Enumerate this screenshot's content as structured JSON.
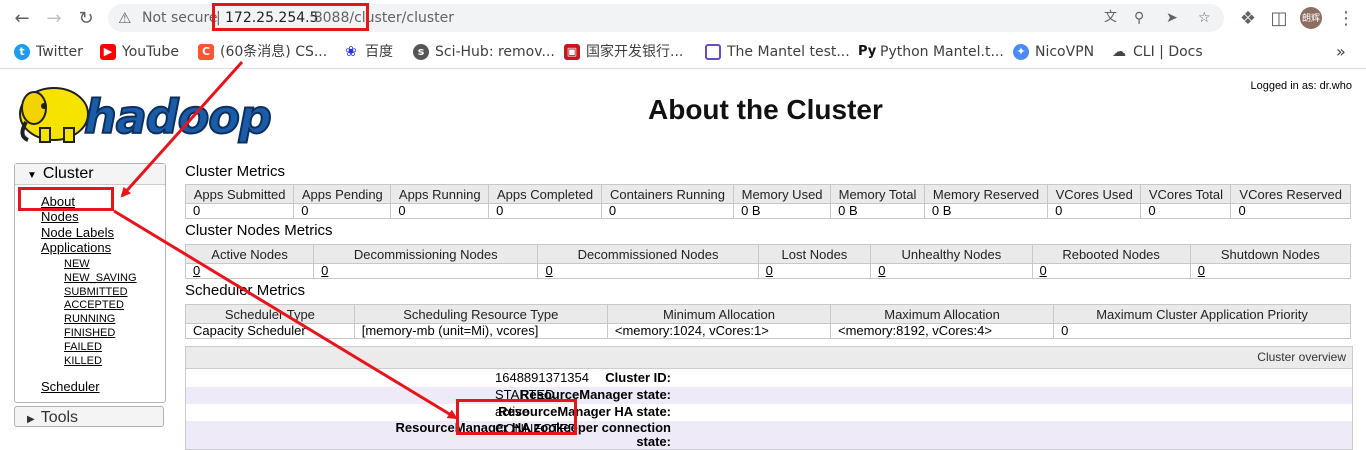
{
  "browser": {
    "security_label": "Not secure",
    "url_host": "172.25.254.5",
    "url_rest": ":8088/cluster/cluster",
    "profile_name": "朗辉"
  },
  "bookmarks": [
    {
      "label": "Twitter",
      "icon": "twitter-bird-icon",
      "color": "#1d9bf0"
    },
    {
      "label": "YouTube",
      "icon": "youtube-icon",
      "color": "#ff0000"
    },
    {
      "label": "(60条消息) CS...",
      "icon": "csdn-icon",
      "color": "#fc5531"
    },
    {
      "label": "百度",
      "icon": "baidu-paw-icon",
      "color": "#2932e1"
    },
    {
      "label": "Sci-Hub: remov...",
      "icon": "scihub-icon",
      "color": "#555555"
    },
    {
      "label": "国家开发银行...",
      "icon": "cdb-icon",
      "color": "#c8161d"
    },
    {
      "label": "The Mantel test...",
      "icon": "page-icon",
      "color": "#6a4bc3"
    },
    {
      "label": "Python Mantel.t...",
      "icon": "py-icon",
      "color": "#111111"
    },
    {
      "label": "NicoVPN",
      "icon": "nicovpn-icon",
      "color": "#4c8bf5"
    },
    {
      "label": "CLI | Docs",
      "icon": "cloud-icon",
      "color": "#444444"
    }
  ],
  "page": {
    "logged_in": "Logged in as: dr.who",
    "title": "About the Cluster",
    "logo_text": "hadoop"
  },
  "sidebar": {
    "cluster_label": "Cluster",
    "links": [
      "About",
      "Nodes",
      "Node Labels",
      "Applications"
    ],
    "app_states": [
      "NEW",
      "NEW_SAVING",
      "SUBMITTED",
      "ACCEPTED",
      "RUNNING",
      "FINISHED",
      "FAILED",
      "KILLED"
    ],
    "scheduler": "Scheduler",
    "tools_label": "Tools"
  },
  "cluster_metrics": {
    "title": "Cluster Metrics",
    "headers": [
      "Apps Submitted",
      "Apps Pending",
      "Apps Running",
      "Apps Completed",
      "Containers Running",
      "Memory Used",
      "Memory Total",
      "Memory Reserved",
      "VCores Used",
      "VCores Total",
      "VCores Reserved"
    ],
    "values": [
      "0",
      "0",
      "0",
      "0",
      "0",
      "0 B",
      "0 B",
      "0 B",
      "0",
      "0",
      "0"
    ]
  },
  "node_metrics": {
    "title": "Cluster Nodes Metrics",
    "headers": [
      "Active Nodes",
      "Decommissioning Nodes",
      "Decommissioned Nodes",
      "Lost Nodes",
      "Unhealthy Nodes",
      "Rebooted Nodes",
      "Shutdown Nodes"
    ],
    "values": [
      "0",
      "0",
      "0",
      "0",
      "0",
      "0",
      "0"
    ]
  },
  "scheduler_metrics": {
    "title": "Scheduler Metrics",
    "headers": [
      "Scheduler Type",
      "Scheduling Resource Type",
      "Minimum Allocation",
      "Maximum Allocation",
      "Maximum Cluster Application Priority"
    ],
    "values": [
      "Capacity Scheduler",
      "[memory-mb (unit=Mi), vcores]",
      "<memory:1024, vCores:1>",
      "<memory:8192, vCores:4>",
      "0"
    ]
  },
  "overview": {
    "header": "Cluster overview",
    "rows": [
      {
        "label": "Cluster ID:",
        "value": "1648891371354"
      },
      {
        "label": "ResourceManager state:",
        "value": "STARTED"
      },
      {
        "label": "ResourceManager HA state:",
        "value": "active"
      },
      {
        "label": "ResourceManager HA zookeeper connection state:",
        "value": "CONNECTED"
      }
    ]
  },
  "colors": {
    "annotation_red": "#e8141b",
    "row_alt": "#eeeaf8",
    "hadoop_yellow": "#f6e400",
    "hadoop_blue": "#1a5ca8"
  }
}
